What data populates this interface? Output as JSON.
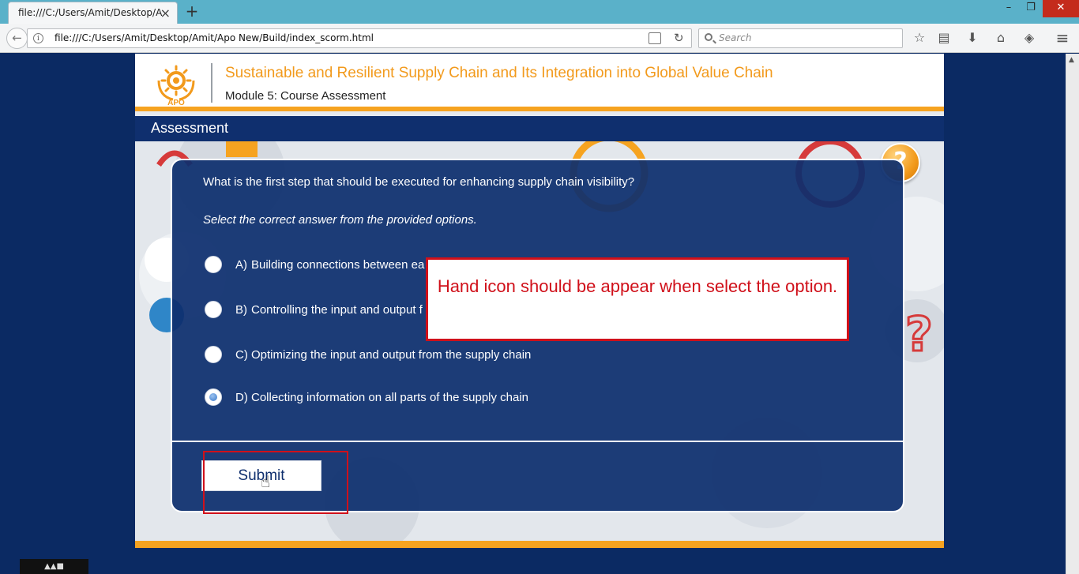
{
  "browser": {
    "tab_title": "file:///C:/Users/Amit/Desktop/A",
    "tab_close": "×",
    "new_tab": "+",
    "url": "file:///C:/Users/Amit/Desktop/Amit/Apo New/Build/index_scorm.html",
    "search_placeholder": "Search",
    "window_controls": {
      "minimize": "–",
      "restore": "❐",
      "close": "✕"
    },
    "toolbar": {
      "back": "←",
      "reload": "↻",
      "bookmark": "☆",
      "library": "▤",
      "download": "⬇",
      "home": "⌂",
      "pocket": "◈",
      "menu": "≡"
    }
  },
  "course": {
    "logo_text": "APO",
    "title": "Sustainable and Resilient Supply Chain and Its Integration into Global Value Chain",
    "module": "Module 5: Course Assessment",
    "section": "Assessment",
    "help_label": "?"
  },
  "quiz": {
    "question": "What is the first step that should be executed for enhancing supply chain visibility?",
    "instruction": "Select the correct answer from the provided options.",
    "options": [
      {
        "letter": "A)",
        "text": "Building connections between ea",
        "selected": false
      },
      {
        "letter": "B)",
        "text": "Controlling the input and output f",
        "selected": false
      },
      {
        "letter": "C)",
        "text": "Optimizing the input and output from the supply chain",
        "selected": false
      },
      {
        "letter": "D)",
        "text": "Collecting information on all parts of the supply chain",
        "selected": true
      }
    ],
    "submit_label": "Submit"
  },
  "annotation": {
    "callout_text": "Hand icon should be appear when select the option.",
    "color": "#d0101a"
  },
  "colors": {
    "navy": "#0f2f6e",
    "orange": "#f6a320",
    "accent_red": "#d0101a"
  }
}
